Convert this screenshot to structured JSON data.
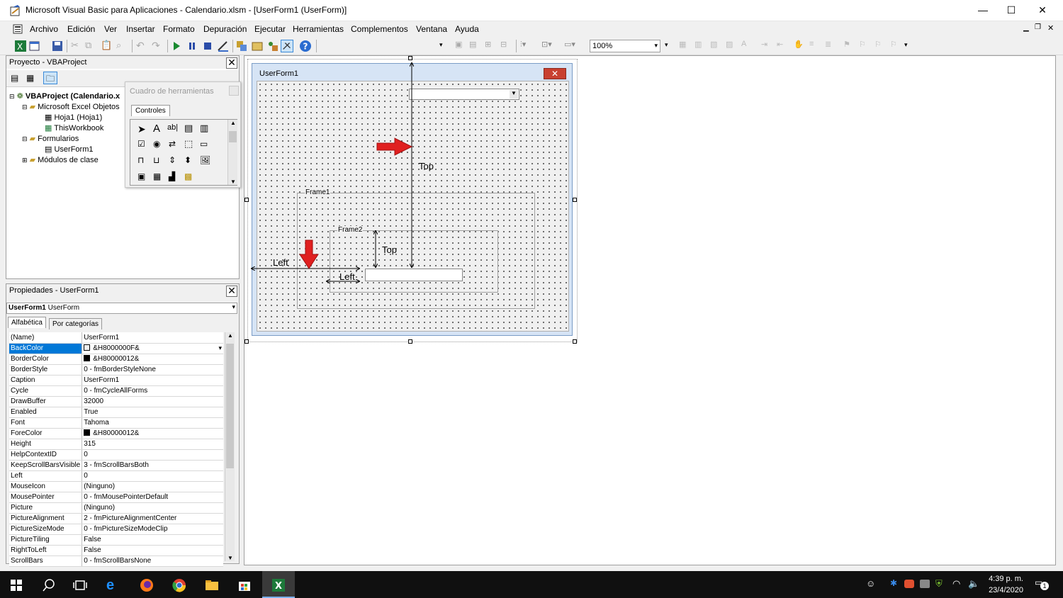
{
  "window": {
    "title": "Microsoft Visual Basic para Aplicaciones - Calendario.xlsm - [UserForm1 (UserForm)]",
    "minimize": "—",
    "maximize": "☐",
    "close": "✕"
  },
  "menu": [
    "Archivo",
    "Edición",
    "Ver",
    "Insertar",
    "Formato",
    "Depuración",
    "Ejecutar",
    "Herramientas",
    "Complementos",
    "Ventana",
    "Ayuda"
  ],
  "toolbar": {
    "zoom": "100%"
  },
  "project": {
    "title": "Proyecto - VBAProject",
    "nodes": [
      "VBAProject (Calendario.x",
      "Microsoft Excel Objetos",
      "Hoja1 (Hoja1)",
      "ThisWorkbook",
      "Formularios",
      "UserForm1",
      "Módulos de clase"
    ]
  },
  "toolbox": {
    "title": "Cuadro de herramientas",
    "tab": "Controles"
  },
  "properties": {
    "title": "Propiedades - UserForm1",
    "object_name": "UserForm1",
    "object_type": "UserForm",
    "tab_alpha": "Alfabética",
    "tab_cat": "Por categorías",
    "rows": [
      {
        "k": "(Name)",
        "v": "UserForm1"
      },
      {
        "k": "BackColor",
        "v": "&H8000000F&",
        "swatch": "#f0f0f0"
      },
      {
        "k": "BorderColor",
        "v": "&H80000012&",
        "swatch": "#000000"
      },
      {
        "k": "BorderStyle",
        "v": "0 - fmBorderStyleNone"
      },
      {
        "k": "Caption",
        "v": "UserForm1"
      },
      {
        "k": "Cycle",
        "v": "0 - fmCycleAllForms"
      },
      {
        "k": "DrawBuffer",
        "v": "32000"
      },
      {
        "k": "Enabled",
        "v": "True"
      },
      {
        "k": "Font",
        "v": "Tahoma"
      },
      {
        "k": "ForeColor",
        "v": "&H80000012&",
        "swatch": "#000000"
      },
      {
        "k": "Height",
        "v": "315"
      },
      {
        "k": "HelpContextID",
        "v": "0"
      },
      {
        "k": "KeepScrollBarsVisible",
        "v": "3 - fmScrollBarsBoth"
      },
      {
        "k": "Left",
        "v": "0"
      },
      {
        "k": "MouseIcon",
        "v": "(Ninguno)"
      },
      {
        "k": "MousePointer",
        "v": "0 - fmMousePointerDefault"
      },
      {
        "k": "Picture",
        "v": "(Ninguno)"
      },
      {
        "k": "PictureAlignment",
        "v": "2 - fmPictureAlignmentCenter"
      },
      {
        "k": "PictureSizeMode",
        "v": "0 - fmPictureSizeModeClip"
      },
      {
        "k": "PictureTiling",
        "v": "False"
      },
      {
        "k": "RightToLeft",
        "v": "False"
      },
      {
        "k": "ScrollBars",
        "v": "0 - fmScrollBarsNone"
      }
    ]
  },
  "form": {
    "caption": "UserForm1",
    "frame1": "Frame1",
    "frame2": "Frame2",
    "label_top": "Top",
    "label_left": "Left",
    "accent": "#e02020"
  },
  "taskbar": {
    "time": "4:39 p. m.",
    "date": "23/4/2020",
    "notifications": "1"
  }
}
